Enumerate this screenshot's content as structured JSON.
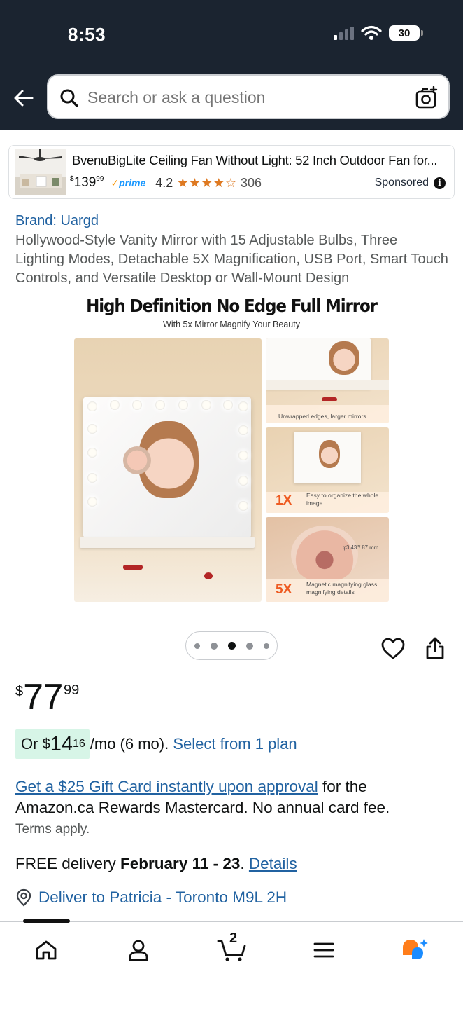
{
  "status_bar": {
    "time": "8:53",
    "battery": "30"
  },
  "search": {
    "placeholder": "Search or ask a question"
  },
  "sponsored": {
    "title": "BvenuBigLite Ceiling Fan Without Light: 52 Inch Outdoor Fan for...",
    "price_currency": "$",
    "price_whole": "139",
    "price_fraction": "99",
    "prime_label": "prime",
    "rating": "4.2",
    "stars": 4.2,
    "review_count": "306",
    "sponsored_label": "Sponsored"
  },
  "product": {
    "brand": "Brand: Uargd",
    "title": "Hollywood-Style Vanity Mirror with 15 Adjustable Bulbs, Three Lighting Modes, Detachable 5X Magnification, USB Port, Smart Touch Controls, and Versatile Desktop or Wall-Mount Design"
  },
  "hero_image": {
    "heading": "High Definition No Edge Full Mirror",
    "subheading": "With 5x Mirror Magnify Your Beauty",
    "panel1_caption": "Unwrapped edges, larger mirrors",
    "panel2_badge": "1X",
    "panel2_caption": "Easy to organize the whole image",
    "panel3_badge": "5X",
    "panel3_dimension": "φ3.43\"/ 87 mm",
    "panel3_caption": "Magnetic magnifying glass, magnifying details"
  },
  "carousel": {
    "total": 5,
    "active_index": 2
  },
  "price": {
    "currency": "$",
    "whole": "77",
    "fraction": "99"
  },
  "monthly": {
    "prefix": "Or",
    "currency": "$",
    "whole": "14",
    "fraction": "16",
    "suffix": "/mo (6 mo).",
    "plan_link": "Select from 1 plan"
  },
  "gift": {
    "link": "Get a $25 Gift Card instantly upon approval",
    "rest": " for the Amazon.ca Rewards Mastercard. No annual card fee.",
    "terms": "Terms apply."
  },
  "delivery": {
    "prefix": "FREE delivery ",
    "dates": "February 11 - 23",
    "period": ". ",
    "details_link": "Details",
    "deliver_to": "Deliver to Patricia - Toronto M9L 2H"
  },
  "bottom_nav": {
    "cart_count": "2",
    "items": [
      "home-icon",
      "account-icon",
      "cart-icon",
      "menu-icon",
      "rufus-icon"
    ]
  },
  "colors": {
    "header_bg": "#1b2430",
    "link": "#2162a1",
    "monthly_badge_bg": "#d7f5e7",
    "star": "#de7921",
    "badge_orange": "#ee5b22",
    "rufus_orange": "#ff7d1a",
    "rufus_blue": "#1a8cff"
  }
}
